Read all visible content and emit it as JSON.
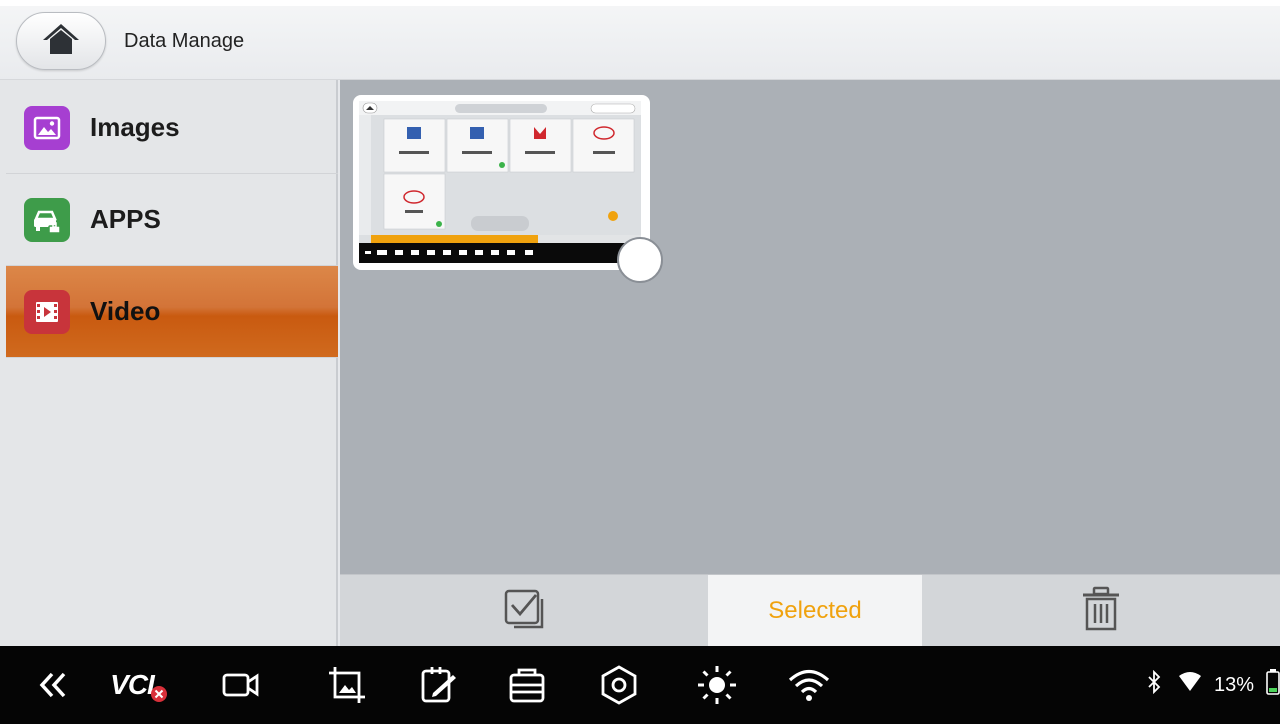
{
  "header": {
    "title": "Data Manage"
  },
  "sidebar": {
    "items": [
      {
        "label": "Images",
        "icon": "image-icon",
        "color": "#a63fd1"
      },
      {
        "label": "APPS",
        "icon": "car-app-icon",
        "color": "#3e9c4a"
      },
      {
        "label": "Video",
        "icon": "video-icon",
        "color": "#c8343b",
        "active": true
      }
    ]
  },
  "content": {
    "thumbnail": {
      "kind": "screenshot-thumbnail",
      "inner_tabs": [
        "车型选择",
        "历史记录",
        "BSS诊断"
      ],
      "inner_search": "请输入关键字",
      "inner_tiles": [
        {
          "name": "中华新能源"
        },
        {
          "name": "中华新能源"
        },
        {
          "name": "比亚迪新能源"
        },
        {
          "name": "比亚迪"
        },
        {
          "name": "比亚迪"
        }
      ]
    }
  },
  "actionbar": {
    "selected_label": "Selected"
  },
  "navbar": {
    "icons": [
      "back-double-chevron-icon",
      "vci-icon",
      "video-camera-icon",
      "screenshot-icon",
      "edit-icon",
      "toolbox-icon",
      "settings-icon",
      "brightness-icon",
      "wifi-icon"
    ],
    "vci_label": "VCI",
    "battery": "13%"
  },
  "colors": {
    "accent": "#d37438",
    "selected_text": "#f0a20e"
  }
}
